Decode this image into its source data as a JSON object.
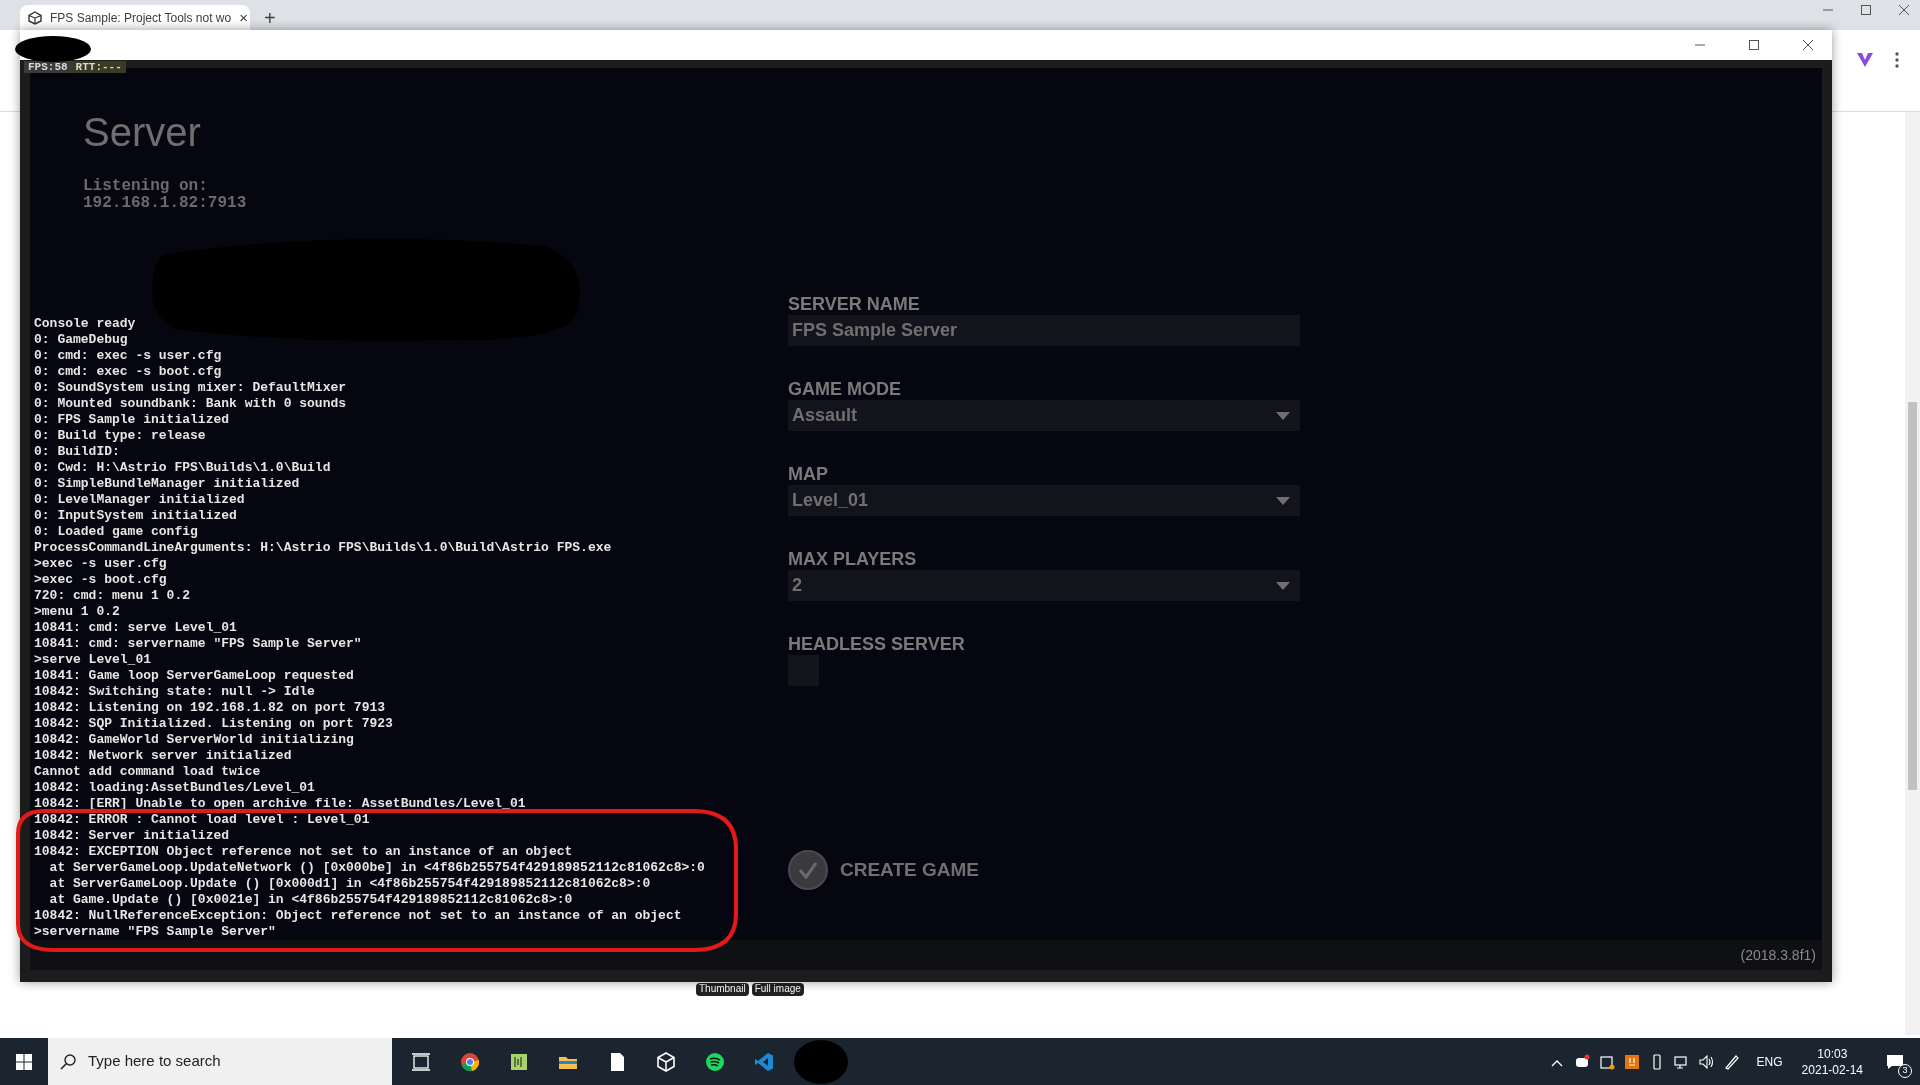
{
  "browser": {
    "tab_title": "FPS Sample: Project Tools not wo",
    "tab_close": "×",
    "new_tab": "+"
  },
  "game_window": {
    "stats": [
      "FPS:58",
      "RTT:---"
    ],
    "heading": "Server",
    "listening_label": "Listening on:",
    "listening_address": "192.168.1.82:7913",
    "console_lines": [
      "Console ready",
      "0: GameDebug",
      "0: cmd: exec -s user.cfg",
      "0: cmd: exec -s boot.cfg",
      "0: SoundSystem using mixer: DefaultMixer",
      "0: Mounted soundbank: Bank with 0 sounds",
      "0: FPS Sample initialized",
      "0: Build type: release",
      "0: BuildID:",
      "0: Cwd: H:\\Astrio FPS\\Builds\\1.0\\Build",
      "0: SimpleBundleManager initialized",
      "0: LevelManager initialized",
      "0: InputSystem initialized",
      "0: Loaded game config",
      "ProcessCommandLineArguments: H:\\Astrio FPS\\Builds\\1.0\\Build\\Astrio FPS.exe",
      ">exec -s user.cfg",
      ">exec -s boot.cfg",
      "720: cmd: menu 1 0.2",
      ">menu 1 0.2",
      "10841: cmd: serve Level_01",
      "10841: cmd: servername \"FPS Sample Server\"",
      ">serve Level_01",
      "10841: Game loop ServerGameLoop requested",
      "10842: Switching state: null -> Idle",
      "10842: Listening on 192.168.1.82 on port 7913",
      "10842: SQP Initialized. Listening on port 7923",
      "10842: GameWorld ServerWorld initializing",
      "10842: Network server initialized",
      "Cannot add command load twice",
      "10842: loading:AssetBundles/Level_01",
      "10842: [ERR] Unable to open archive file: AssetBundles/Level_01",
      "10842: ERROR : Cannot load level : Level_01",
      "10842: Server initialized",
      "10842: EXCEPTION Object reference not set to an instance of an object",
      "  at ServerGameLoop.UpdateNetwork () [0x000be] in <4f86b255754f429189852112c81062c8>:0",
      "  at ServerGameLoop.Update () [0x000d1] in <4f86b255754f429189852112c81062c8>:0",
      "  at Game.Update () [0x0021e] in <4f86b255754f429189852112c81062c8>:0",
      "10842: NullReferenceException: Object reference not set to an instance of an object",
      ">servername \"FPS Sample Server\""
    ],
    "form": {
      "fields": [
        {
          "kind": "text",
          "label": "SERVER NAME",
          "value": "FPS Sample Server"
        },
        {
          "kind": "dropdown",
          "label": "GAME MODE",
          "value": "Assault"
        },
        {
          "kind": "dropdown",
          "label": "MAP",
          "value": "Level_01"
        },
        {
          "kind": "dropdown",
          "label": "MAX PLAYERS",
          "value": "2"
        },
        {
          "kind": "checkbox",
          "label": "HEADLESS SERVER",
          "checked": false
        }
      ],
      "create_button": "CREATE GAME"
    },
    "version": "(2018.3.8f1)"
  },
  "page_behind": {
    "buttons": [
      "Thumbnail",
      "Full image"
    ]
  },
  "taskbar": {
    "search_placeholder": "Type here to search",
    "language": "ENG",
    "time": "10:03",
    "date": "2021-02-14",
    "notification_count": "3"
  }
}
